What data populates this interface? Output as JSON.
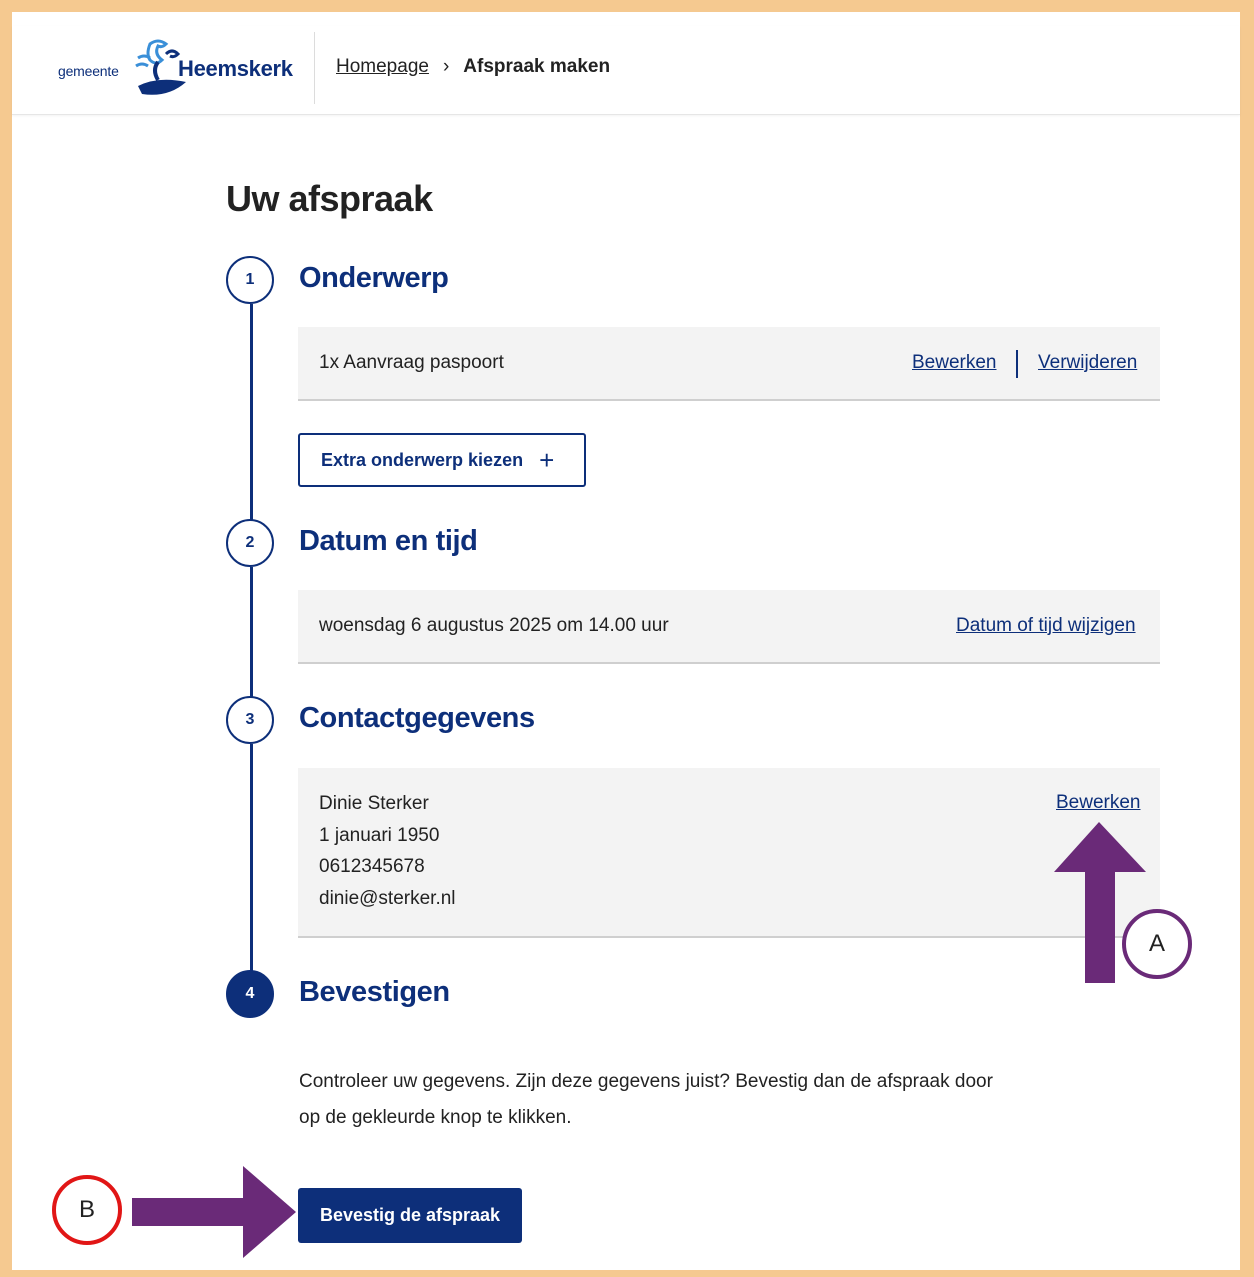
{
  "header": {
    "logo_small": "gemeente",
    "logo_big": "Heemskerk",
    "breadcrumb": {
      "home": "Homepage",
      "separator": "›",
      "current": "Afspraak maken"
    }
  },
  "page_title": "Uw afspraak",
  "steps": [
    {
      "number": "1",
      "title": "Onderwerp",
      "item": "1x Aanvraag paspoort",
      "edit_link": "Bewerken",
      "delete_link": "Verwijderen",
      "extra_button": "Extra onderwerp kiezen",
      "plus_icon": "+"
    },
    {
      "number": "2",
      "title": "Datum en tijd",
      "item": "woensdag 6 augustus 2025 om 14.00 uur",
      "change_link": "Datum of tijd wijzigen"
    },
    {
      "number": "3",
      "title": "Contactgegevens",
      "lines": [
        "Dinie Sterker",
        "1 januari 1950",
        "0612345678",
        "dinie@sterker.nl"
      ],
      "edit_link": "Bewerken"
    },
    {
      "number": "4",
      "title": "Bevestigen",
      "text": "Controleer uw gegevens. Zijn deze gegevens juist? Bevestig dan de afspraak door op de gekleurde knop te klikken.",
      "confirm_button": "Bevestig de afspraak"
    }
  ],
  "annotations": {
    "a": "A",
    "b": "B"
  },
  "colors": {
    "brand": "#0d2f7a",
    "frame": "#f5c990",
    "arrow": "#6a2a78",
    "circle_b": "#e11616",
    "card": "#f3f3f3"
  }
}
